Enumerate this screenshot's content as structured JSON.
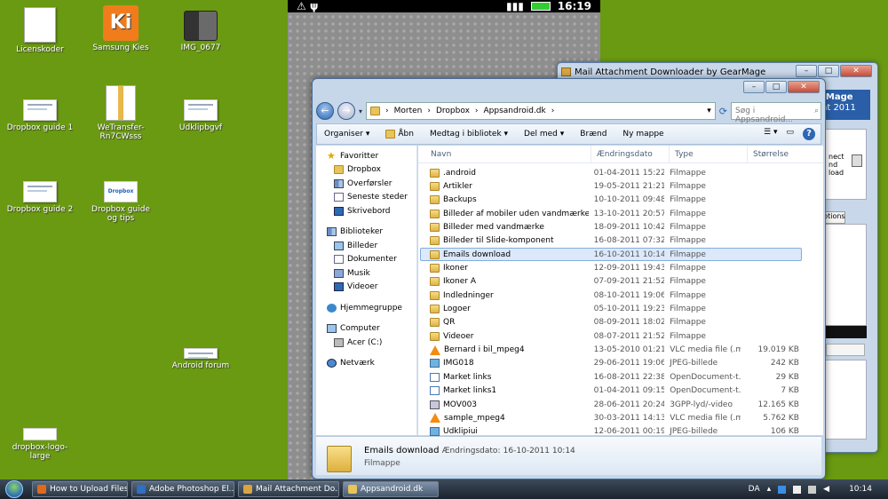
{
  "desktop": {
    "icons": [
      {
        "label": "Licenskoder"
      },
      {
        "label": "Samsung Kies"
      },
      {
        "label": "IMG_0677"
      },
      {
        "label": "Dropbox guide 1"
      },
      {
        "label": "WeTransfer-Rn7CWsss"
      },
      {
        "label": "Udklipbgvf"
      },
      {
        "label": "Dropbox guide 2"
      },
      {
        "label": "Dropbox guide og tips"
      },
      {
        "label": "Android forum"
      },
      {
        "label": "dropbox-logo-large"
      }
    ],
    "kies_glyph": "Ki",
    "dropbox_badge": "Dropbox"
  },
  "phone": {
    "time": "16:19"
  },
  "mail_window": {
    "title": "Mail Attachment Downloader by GearMage",
    "banner_line1": "rMage",
    "banner_line2": "ht 2011",
    "panel_line1": "nect",
    "panel_line2": "nd",
    "panel_line3": "load",
    "tab_label": "ptions"
  },
  "explorer": {
    "breadcrumb": [
      "Morten",
      "Dropbox",
      "Appsandroid.dk"
    ],
    "search_placeholder": "Søg i Appsandroid...",
    "toolbar": {
      "organize": "Organiser ▾",
      "open": "Åbn",
      "share": "Medtag i bibliotek ▾",
      "share_with": "Del med ▾",
      "burn": "Brænd",
      "new_folder": "Ny mappe"
    },
    "nav": {
      "favorites": "Favoritter",
      "dropbox": "Dropbox",
      "downloads": "Overførsler",
      "recent": "Seneste steder",
      "desktop": "Skrivebord",
      "libraries": "Biblioteker",
      "pictures": "Billeder",
      "documents": "Dokumenter",
      "music": "Musik",
      "videos": "Videoer",
      "homegroup": "Hjemmegruppe",
      "computer": "Computer",
      "drive": "Acer (C:)",
      "network": "Netværk"
    },
    "columns": {
      "name": "Navn",
      "date": "Ændringsdato",
      "type": "Type",
      "size": "Størrelse"
    },
    "files": [
      {
        "name": ".android",
        "date": "01-04-2011 15:22",
        "type": "Filmappe",
        "size": "",
        "kind": "folder"
      },
      {
        "name": "Artikler",
        "date": "19-05-2011 21:21",
        "type": "Filmappe",
        "size": "",
        "kind": "folder"
      },
      {
        "name": "Backups",
        "date": "10-10-2011 09:48",
        "type": "Filmappe",
        "size": "",
        "kind": "folder"
      },
      {
        "name": "Billeder af mobiler uden vandmærke",
        "date": "13-10-2011 20:57",
        "type": "Filmappe",
        "size": "",
        "kind": "folder"
      },
      {
        "name": "Billeder med vandmærke",
        "date": "18-09-2011 10:42",
        "type": "Filmappe",
        "size": "",
        "kind": "folder"
      },
      {
        "name": "Billeder til Slide-komponent",
        "date": "16-08-2011 07:32",
        "type": "Filmappe",
        "size": "",
        "kind": "folder"
      },
      {
        "name": "Emails download",
        "date": "16-10-2011 10:14",
        "type": "Filmappe",
        "size": "",
        "kind": "folder",
        "selected": true
      },
      {
        "name": "Ikoner",
        "date": "12-09-2011 19:43",
        "type": "Filmappe",
        "size": "",
        "kind": "folder"
      },
      {
        "name": "Ikoner A",
        "date": "07-09-2011 21:52",
        "type": "Filmappe",
        "size": "",
        "kind": "folder"
      },
      {
        "name": "Indledninger",
        "date": "08-10-2011 19:06",
        "type": "Filmappe",
        "size": "",
        "kind": "folder"
      },
      {
        "name": "Logoer",
        "date": "05-10-2011 19:23",
        "type": "Filmappe",
        "size": "",
        "kind": "folder"
      },
      {
        "name": "QR",
        "date": "08-09-2011 18:02",
        "type": "Filmappe",
        "size": "",
        "kind": "folder"
      },
      {
        "name": "Videoer",
        "date": "08-07-2011 21:52",
        "type": "Filmappe",
        "size": "",
        "kind": "folder"
      },
      {
        "name": "Bernard i bil_mpeg4",
        "date": "13-05-2010 01:21",
        "type": "VLC media file (.m...",
        "size": "19.019 KB",
        "kind": "vlc"
      },
      {
        "name": "IMG018",
        "date": "29-06-2011 19:06",
        "type": "JPEG-billede",
        "size": "242 KB",
        "kind": "jpg"
      },
      {
        "name": "Market links",
        "date": "16-08-2011 22:38",
        "type": "OpenDocument-t...",
        "size": "29 KB",
        "kind": "odt"
      },
      {
        "name": "Market links1",
        "date": "01-04-2011 09:15",
        "type": "OpenDocument-t...",
        "size": "7 KB",
        "kind": "odt"
      },
      {
        "name": "MOV003",
        "date": "28-06-2011 20:24",
        "type": "3GPP-lyd/-video",
        "size": "12.165 KB",
        "kind": "3gp"
      },
      {
        "name": "sample_mpeg4",
        "date": "30-03-2011 14:13",
        "type": "VLC media file (.m...",
        "size": "5.762 KB",
        "kind": "vlc"
      },
      {
        "name": "Udklipiui",
        "date": "12-06-2011 00:19",
        "type": "JPEG-billede",
        "size": "106 KB",
        "kind": "jpg"
      }
    ],
    "details": {
      "name": "Emails download",
      "date_label": "Ændringsdato:",
      "date_value": "16-10-2011 10:14",
      "type": "Filmappe"
    }
  },
  "taskbar": {
    "tasks": [
      {
        "label": "How to Upload Files ...",
        "color": "#e06a1b"
      },
      {
        "label": "Adobe Photoshop El...",
        "color": "#2f6fc4"
      },
      {
        "label": "Mail Attachment Do...",
        "color": "#d9a441"
      },
      {
        "label": "Appsandroid.dk",
        "color": "#e8c45a"
      }
    ],
    "language": "DA",
    "time": "10:14"
  }
}
